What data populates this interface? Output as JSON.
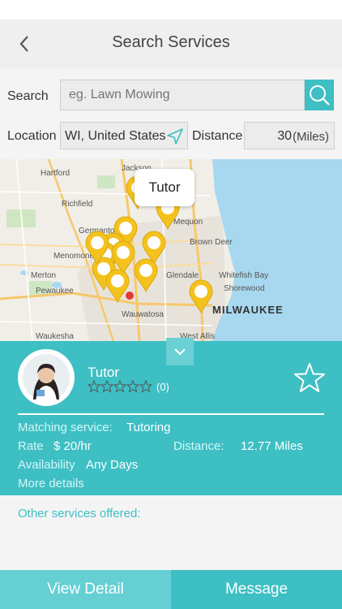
{
  "header": {
    "title": "Search Services",
    "back_icon": "chevron-left-icon"
  },
  "search": {
    "label": "Search",
    "placeholder": "eg. Lawn Mowing",
    "button_icon": "search-icon"
  },
  "location": {
    "label": "Location",
    "value": "WI, United States",
    "icon": "location-arrow-icon"
  },
  "distance": {
    "label": "Distance",
    "value": "30",
    "unit": "(Miles)"
  },
  "map": {
    "tooltip": "Tutor",
    "places": [
      "Hartford",
      "Jackson",
      "Richfield",
      "Germantown",
      "Mequon",
      "Brown Deer",
      "Menomonee Falls",
      "Merton",
      "Whitefish Bay",
      "Shorewood",
      "Pewaukee",
      "Wauwatosa",
      "MILWAUKEE",
      "Waukesha",
      "West Allis",
      "Glendale"
    ]
  },
  "provider": {
    "name": "Tutor",
    "rating_count": "(0)",
    "stars": 0,
    "max_stars": 5,
    "matching_label": "Matching service:",
    "matching_value": "Tutoring",
    "rate_label": "Rate",
    "rate_value": "$ 20/hr",
    "distance_label": "Distance:",
    "distance_value": "12.77 Miles",
    "availability_label": "Availability",
    "availability_value": "Any Days",
    "more_details": "More details"
  },
  "other_services_label": "Other services offered:",
  "buttons": {
    "view_detail": "View Detail",
    "message": "Message"
  },
  "colors": {
    "accent": "#3dbfc4",
    "accent_light": "#65cfd3",
    "map_water": "#a8d8f0",
    "pin": "#f4c21d"
  }
}
